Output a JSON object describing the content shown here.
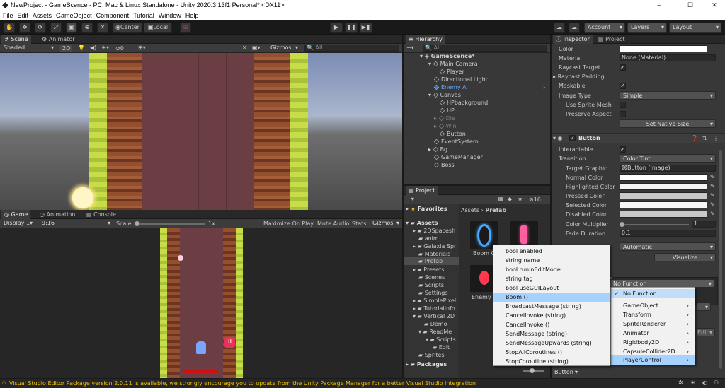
{
  "window": {
    "title": "NewProject - GameScence - PC, Mac & Linux Standalone - Unity 2020.3.13f1 Personal* <DX11>",
    "min": "–",
    "max": "☐",
    "close": "✕"
  },
  "menubar": [
    "File",
    "Edit",
    "Assets",
    "GameObject",
    "Component",
    "Tutorial",
    "Window",
    "Help"
  ],
  "toolbar": {
    "center": "Center",
    "local": "Local",
    "account": "Account",
    "layers": "Layers",
    "layout": "Layout"
  },
  "scene": {
    "tab_scene": "Scene",
    "tab_animator": "Animator",
    "shading": "Shaded",
    "mode2d": "2D",
    "fx_count": "0",
    "gizmos": "Gizmos",
    "search": "All"
  },
  "game": {
    "tab_game": "Game",
    "tab_animation": "Animation",
    "tab_console": "Console",
    "display": "Display 1",
    "aspect": "9:16",
    "scale_label": "Scale",
    "scale_value": "1x",
    "maximize": "Maximize On Play",
    "mute": "Mute Audio",
    "stats": "Stats",
    "gizmos": "Gizmos"
  },
  "hierarchy": {
    "title": "Hierarchy",
    "search": "All",
    "items": [
      {
        "label": "GameScence*",
        "color": "#d8d8d8"
      },
      {
        "label": "Main Camera",
        "color": "#cdcdcd"
      },
      {
        "label": "Player",
        "color": "#cdcdcd"
      },
      {
        "label": "Directional Light",
        "color": "#cdcdcd"
      },
      {
        "label": "Enemy A",
        "color": "#6fa8ff"
      },
      {
        "label": "Canvas",
        "color": "#cdcdcd"
      },
      {
        "label": "HPbackground",
        "color": "#cdcdcd"
      },
      {
        "label": "HP",
        "color": "#cdcdcd"
      },
      {
        "label": "Die",
        "color": "#7d7d7d"
      },
      {
        "label": "Win",
        "color": "#7d7d7d"
      },
      {
        "label": "Button",
        "color": "#cdcdcd"
      },
      {
        "label": "EventSystem",
        "color": "#cdcdcd"
      },
      {
        "label": "Bg",
        "color": "#cdcdcd"
      },
      {
        "label": "GameManager",
        "color": "#cdcdcd"
      },
      {
        "label": "Boss",
        "color": "#cdcdcd"
      }
    ]
  },
  "project": {
    "title": "Project",
    "count": "16",
    "favorites": "Favorites",
    "breadcrumb": [
      "Assets",
      "Prefab"
    ],
    "tree": [
      "Assets",
      "2DSpacesh",
      "anim",
      "Galaxia Spr",
      "Materials",
      "Prefab",
      "Presets",
      "Scenes",
      "Scripts",
      "Settings",
      "SimplePixel",
      "TutorialInfo",
      "Vertical 2D",
      "Demo",
      "ReadMe",
      "Scripts",
      "Edit",
      "Sprites",
      "Packages"
    ],
    "assets": [
      "Boom 0",
      "Enemy A"
    ]
  },
  "inspector": {
    "tab_inspector": "Inspector",
    "tab_project": "Project",
    "rows": {
      "color": "Color",
      "material": "Material",
      "material_value": "None (Material)",
      "raycast_target": "Raycast Target",
      "raycast_padding": "Raycast Padding",
      "maskable": "Maskable",
      "image_type": "Image Type",
      "image_type_value": "Simple",
      "use_sprite_mesh": "Use Sprite Mesh",
      "preserve_aspect": "Preserve Aspect",
      "set_native_size": "Set Native Size"
    },
    "button": {
      "title": "Button",
      "interactable": "Interactable",
      "transition": "Transition",
      "transition_value": "Color Tint",
      "target_graphic": "Target Graphic",
      "target_graphic_value": "Button (Image)",
      "normal": "Normal Color",
      "highlighted": "Highlighted Color",
      "pressed": "Pressed Color",
      "selected": "Selected Color",
      "disabled": "Disabled Color",
      "multiplier": "Color Multiplier",
      "multiplier_value": "1",
      "fade": "Fade Duration",
      "fade_value": "0.1",
      "navigation_value": "Automatic",
      "visualize": "Visualize",
      "function_value": "No Function",
      "edit": "Edit...",
      "minus": "−",
      "footer": "Button"
    }
  },
  "function_menu": {
    "items": [
      "No Function",
      "GameObject",
      "Transform",
      "SpriteRenderer",
      "Animator",
      "Rigidbody2D",
      "CapsuleCollider2D",
      "PlayerControl"
    ]
  },
  "method_menu": {
    "items": [
      "bool enabled",
      "string name",
      "bool runInEditMode",
      "string tag",
      "bool useGUILayout",
      "Boom ()",
      "BroadcastMessage (string)",
      "CancelInvoke (string)",
      "CancelInvoke ()",
      "SendMessage (string)",
      "SendMessageUpwards (string)",
      "StopAllCoroutines ()",
      "StopCoroutine (string)"
    ]
  },
  "status": {
    "message": "Visual Studio Editor Package version 2.0.11 is available, we strongly encourage you to update from the Unity Package Manager for a better Visual Studio integration"
  },
  "colors": {
    "accent": "#3a79bb",
    "warning": "#f0c000",
    "hp_bar": "#d01010"
  }
}
